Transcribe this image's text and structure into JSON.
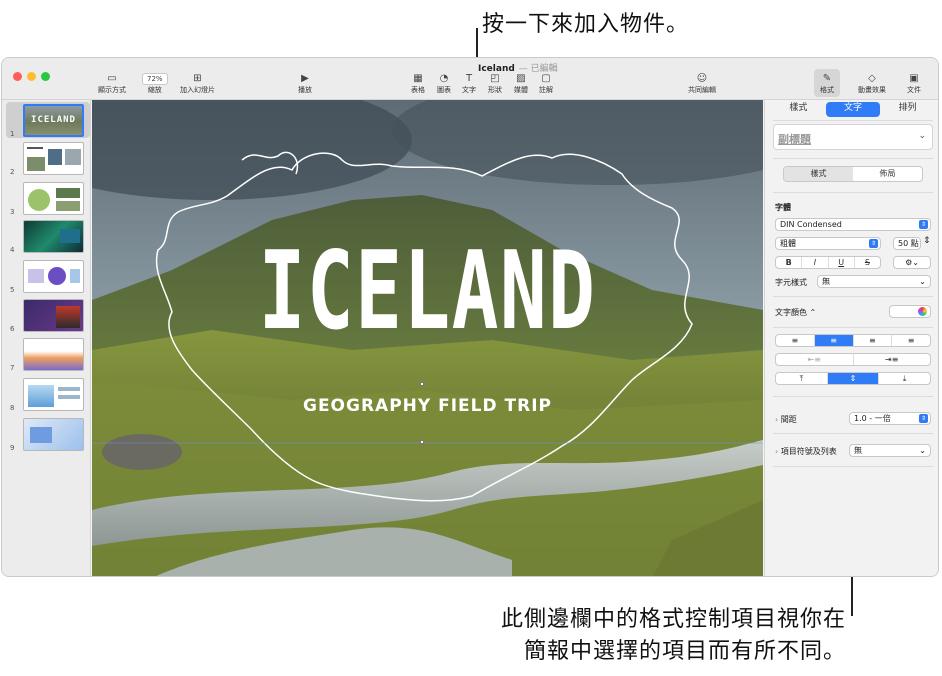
{
  "callouts": {
    "top": "按一下來加入物件。",
    "bottom_line1": "此側邊欄中的格式控制項目視你在",
    "bottom_line2": "簡報中選擇的項目而有所不同。"
  },
  "window": {
    "title": "Iceland",
    "title_suffix": "— 已編輯"
  },
  "toolbar": {
    "view": "顯示方式",
    "zoom_value": "72%",
    "zoom": "縮放",
    "add_slide": "加入幻燈片",
    "play": "播放",
    "table": "表格",
    "chart": "圖表",
    "text": "文字",
    "shape": "形狀",
    "media": "媒體",
    "comment": "註解",
    "collaborate": "共同編輯",
    "format": "格式",
    "animate": "動畫效果",
    "document": "文件"
  },
  "slides": [
    {
      "num": "1",
      "label": "ICELAND"
    },
    {
      "num": "2"
    },
    {
      "num": "3"
    },
    {
      "num": "4"
    },
    {
      "num": "5"
    },
    {
      "num": "6"
    },
    {
      "num": "7"
    },
    {
      "num": "8"
    },
    {
      "num": "9"
    }
  ],
  "slide": {
    "title": "ICELAND",
    "subtitle": "GEOGRAPHY FIELD TRIP"
  },
  "sidebar": {
    "tabs": [
      "樣式",
      "文字",
      "排列"
    ],
    "paragraph_style": "副標題",
    "subtabs": [
      "樣式",
      "佈局"
    ],
    "font_heading": "字體",
    "font_name": "DIN Condensed",
    "font_weight": "粗體",
    "font_size": "50 點",
    "bold": "B",
    "italic": "I",
    "underline": "U",
    "strike": "S",
    "char_style_label": "字元樣式",
    "char_style_value": "無",
    "text_color_label": "文字顏色 ⌃",
    "spacing_label": "間距",
    "spacing_value": "1.0 - 一倍",
    "bullets_label": "項目符號及列表",
    "bullets_value": "無"
  },
  "colors": {
    "accent": "#2f7cf6",
    "traffic_red": "#fe5f57",
    "traffic_yellow": "#febc2e",
    "traffic_green": "#28c840"
  }
}
